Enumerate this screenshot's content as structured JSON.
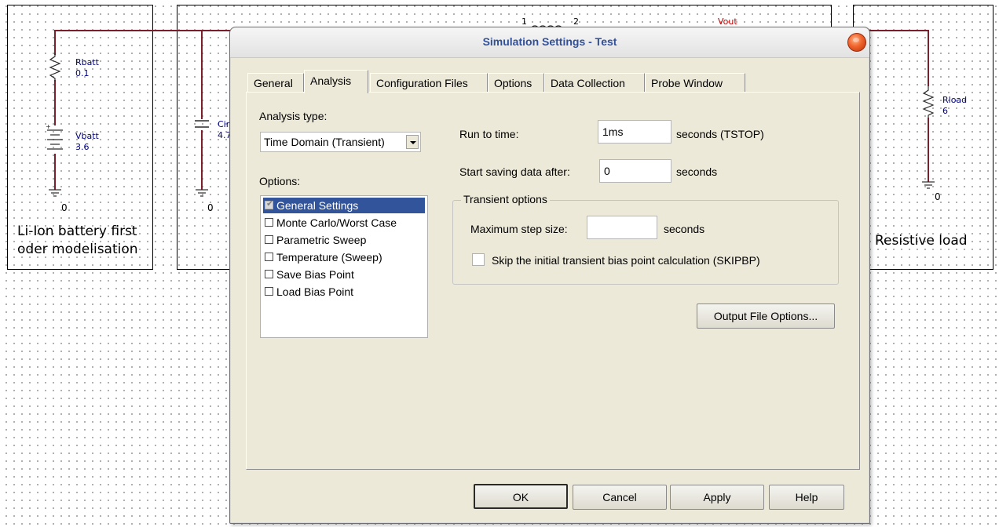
{
  "schematic": {
    "battery_block": {
      "rbatt_name": "Rbatt",
      "rbatt_value": "0.1",
      "vbatt_name": "Vbatt",
      "vbatt_value": "3.6",
      "ground": "0",
      "caption_line1": "Li-Ion battery first",
      "caption_line2": "oder modelisation"
    },
    "middle_block": {
      "cap_name": "Cin",
      "cap_value": "4.7",
      "ground": "0",
      "node1": "1",
      "node2": "2",
      "vout_label": "Vout"
    },
    "load_block": {
      "rload_name": "Rload",
      "rload_value": "6",
      "ground": "0",
      "caption": "Resistive load"
    }
  },
  "dialog": {
    "title": "Simulation Settings - Test",
    "tabs": [
      {
        "label": "General"
      },
      {
        "label": "Analysis"
      },
      {
        "label": "Configuration Files"
      },
      {
        "label": "Options"
      },
      {
        "label": "Data Collection"
      },
      {
        "label": "Probe Window"
      }
    ],
    "active_tab": "Analysis",
    "analysis_type_label": "Analysis type:",
    "analysis_type_value": "Time Domain (Transient)",
    "options_label": "Options:",
    "options": [
      {
        "label": "General Settings",
        "checked": true
      },
      {
        "label": "Monte Carlo/Worst Case",
        "checked": false
      },
      {
        "label": "Parametric Sweep",
        "checked": false
      },
      {
        "label": "Temperature (Sweep)",
        "checked": false
      },
      {
        "label": "Save Bias Point",
        "checked": false
      },
      {
        "label": "Load Bias Point",
        "checked": false
      }
    ],
    "run_to_time_label": "Run to time:",
    "run_to_time_value": "1ms",
    "run_to_time_unit": "seconds  (TSTOP)",
    "start_saving_label": "Start saving data after:",
    "start_saving_value": "0",
    "start_saving_unit": "seconds",
    "transient_group_title": "Transient options",
    "max_step_label": "Maximum step size:",
    "max_step_value": "",
    "max_step_unit": "seconds",
    "skipbp_label": "Skip the initial transient bias point calculation  (SKIPBP)",
    "output_file_options_label": "Output File Options...",
    "ok_label": "OK",
    "cancel_label": "Cancel",
    "apply_label": "Apply",
    "help_label": "Help"
  },
  "colors": {
    "wire": "#7a1f2b",
    "title_text": "#30509a",
    "selection": "#31549b",
    "dialog_bg": "#ece9d8"
  }
}
